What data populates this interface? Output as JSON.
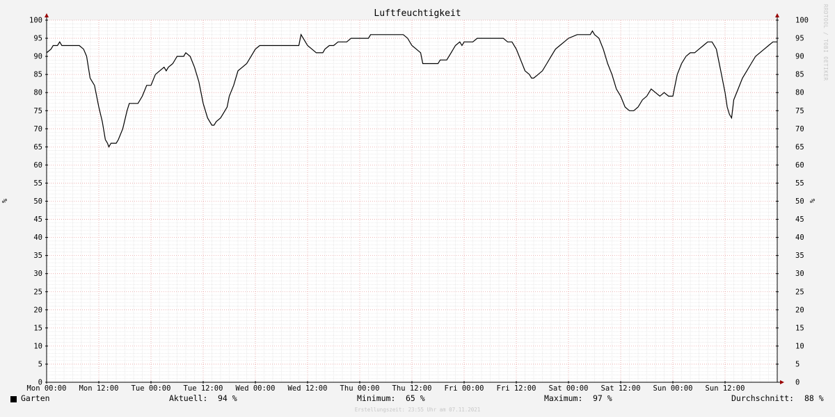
{
  "chart_data": {
    "type": "line",
    "title": "Luftfeuchtigkeit",
    "ylabel": "%",
    "ylim": [
      0,
      100
    ],
    "yticks": [
      0,
      5,
      10,
      15,
      20,
      25,
      30,
      35,
      40,
      45,
      50,
      55,
      60,
      65,
      70,
      75,
      80,
      85,
      90,
      95,
      100
    ],
    "xlim": [
      0,
      168
    ],
    "xticks": [
      {
        "x": 0,
        "label": "Mon 00:00"
      },
      {
        "x": 12,
        "label": "Mon 12:00"
      },
      {
        "x": 24,
        "label": "Tue 00:00"
      },
      {
        "x": 36,
        "label": "Tue 12:00"
      },
      {
        "x": 48,
        "label": "Wed 00:00"
      },
      {
        "x": 60,
        "label": "Wed 12:00"
      },
      {
        "x": 72,
        "label": "Thu 00:00"
      },
      {
        "x": 84,
        "label": "Thu 12:00"
      },
      {
        "x": 96,
        "label": "Fri 00:00"
      },
      {
        "x": 108,
        "label": "Fri 12:00"
      },
      {
        "x": 120,
        "label": "Sat 00:00"
      },
      {
        "x": 132,
        "label": "Sat 12:00"
      },
      {
        "x": 144,
        "label": "Sun 00:00"
      },
      {
        "x": 156,
        "label": "Sun 12:00"
      }
    ],
    "grid": true,
    "series": [
      {
        "name": "Garten",
        "color": "#000000",
        "points": [
          [
            0,
            91
          ],
          [
            1,
            92
          ],
          [
            1.5,
            93
          ],
          [
            2.5,
            93
          ],
          [
            3,
            94
          ],
          [
            3.5,
            93
          ],
          [
            7.5,
            93
          ],
          [
            8.5,
            92
          ],
          [
            9.2,
            90
          ],
          [
            10,
            84
          ],
          [
            11,
            82
          ],
          [
            12,
            76
          ],
          [
            12.8,
            72
          ],
          [
            13.5,
            67
          ],
          [
            14,
            66
          ],
          [
            14.3,
            65
          ],
          [
            14.8,
            66
          ],
          [
            16,
            66
          ],
          [
            16.5,
            67
          ],
          [
            17.5,
            70
          ],
          [
            18.5,
            75
          ],
          [
            19,
            77
          ],
          [
            21,
            77
          ],
          [
            22,
            79
          ],
          [
            23,
            82
          ],
          [
            24,
            82
          ],
          [
            25,
            85
          ],
          [
            26,
            86
          ],
          [
            27,
            87
          ],
          [
            27.5,
            86
          ],
          [
            28,
            87
          ],
          [
            29,
            88
          ],
          [
            30,
            90
          ],
          [
            31.5,
            90
          ],
          [
            32,
            91
          ],
          [
            33,
            90
          ],
          [
            34,
            87
          ],
          [
            35,
            83
          ],
          [
            36,
            77
          ],
          [
            37,
            73
          ],
          [
            38,
            71
          ],
          [
            38.5,
            71
          ],
          [
            39,
            72
          ],
          [
            40,
            73
          ],
          [
            41,
            75
          ],
          [
            41.5,
            76
          ],
          [
            42,
            79
          ],
          [
            43,
            82
          ],
          [
            44,
            86
          ],
          [
            45,
            87
          ],
          [
            46,
            88
          ],
          [
            47,
            90
          ],
          [
            48,
            92
          ],
          [
            49,
            93
          ],
          [
            58,
            93
          ],
          [
            58.5,
            96
          ],
          [
            59,
            95
          ],
          [
            60,
            93
          ],
          [
            61,
            92
          ],
          [
            62,
            91
          ],
          [
            63.5,
            91
          ],
          [
            64,
            92
          ],
          [
            65,
            93
          ],
          [
            66,
            93
          ],
          [
            67,
            94
          ],
          [
            69,
            94
          ],
          [
            70,
            95
          ],
          [
            74,
            95
          ],
          [
            74.5,
            96
          ],
          [
            82,
            96
          ],
          [
            83,
            95
          ],
          [
            84,
            93
          ],
          [
            85,
            92
          ],
          [
            86,
            91
          ],
          [
            86.5,
            88
          ],
          [
            87,
            88
          ],
          [
            90,
            88
          ],
          [
            90.5,
            89
          ],
          [
            92,
            89
          ],
          [
            93,
            91
          ],
          [
            94,
            93
          ],
          [
            95,
            94
          ],
          [
            95.5,
            93
          ],
          [
            96,
            94
          ],
          [
            98,
            94
          ],
          [
            99,
            95
          ],
          [
            105,
            95
          ],
          [
            106,
            94
          ],
          [
            107,
            94
          ],
          [
            108,
            92
          ],
          [
            109,
            89
          ],
          [
            110,
            86
          ],
          [
            111,
            85
          ],
          [
            111.5,
            84
          ],
          [
            112,
            84
          ],
          [
            113,
            85
          ],
          [
            114,
            86
          ],
          [
            115,
            88
          ],
          [
            116,
            90
          ],
          [
            117,
            92
          ],
          [
            118,
            93
          ],
          [
            119,
            94
          ],
          [
            120,
            95
          ],
          [
            122,
            96
          ],
          [
            125,
            96
          ],
          [
            125.5,
            97
          ],
          [
            126,
            96
          ],
          [
            127,
            95
          ],
          [
            128,
            92
          ],
          [
            129,
            88
          ],
          [
            130,
            85
          ],
          [
            131,
            81
          ],
          [
            132,
            79
          ],
          [
            133,
            76
          ],
          [
            134,
            75
          ],
          [
            135,
            75
          ],
          [
            136,
            76
          ],
          [
            137,
            78
          ],
          [
            138,
            79
          ],
          [
            139,
            81
          ],
          [
            140,
            80
          ],
          [
            141,
            79
          ],
          [
            142,
            80
          ],
          [
            143,
            79
          ],
          [
            144,
            79
          ],
          [
            144.5,
            82
          ],
          [
            145,
            85
          ],
          [
            146,
            88
          ],
          [
            147,
            90
          ],
          [
            148,
            91
          ],
          [
            149,
            91
          ],
          [
            150,
            92
          ],
          [
            151,
            93
          ],
          [
            152,
            94
          ],
          [
            153,
            94
          ],
          [
            154,
            92
          ],
          [
            155,
            86
          ],
          [
            156,
            80
          ],
          [
            156.5,
            76
          ],
          [
            157,
            74
          ],
          [
            157.5,
            73
          ],
          [
            158,
            78
          ],
          [
            159,
            81
          ],
          [
            160,
            84
          ],
          [
            161,
            86
          ],
          [
            162,
            88
          ],
          [
            163,
            90
          ],
          [
            164,
            91
          ],
          [
            165,
            92
          ],
          [
            166,
            93
          ],
          [
            167,
            94
          ],
          [
            168,
            94
          ]
        ]
      }
    ],
    "legend": {
      "name": "Garten",
      "current_label": "Aktuell:",
      "current_value": "94 %",
      "min_label": "Minimum:",
      "min_value": "65 %",
      "max_label": "Maximum:",
      "max_value": "97 %",
      "avg_label": "Durchschnitt:",
      "avg_value": "88 %"
    },
    "footer": "Erstellungszeit: 23:55 Uhr am 07.11.2021",
    "watermark": "RRDTOOL / TOBI OETIKER",
    "colors": {
      "background": "#f3f3f3",
      "canvas": "#ffffff",
      "minor_grid": "#dcdcdc",
      "major_grid": "#e8a0a0",
      "axis": "#000000",
      "arrow": "#990000"
    }
  }
}
